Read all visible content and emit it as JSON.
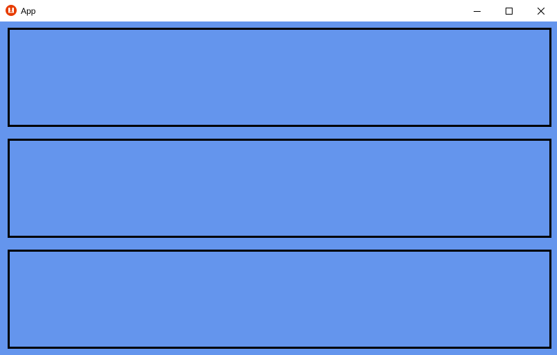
{
  "window": {
    "title": "App",
    "app_icon": "monogame-logo-icon",
    "background_color": "#6495ED",
    "titlebar_color": "#FFFFFF",
    "controls": {
      "minimize": "minimize-icon",
      "maximize": "maximize-icon",
      "close": "close-icon"
    }
  },
  "panels": [
    {
      "border_color": "#000000"
    },
    {
      "border_color": "#000000"
    },
    {
      "border_color": "#000000"
    }
  ],
  "brand_color": "#E73C00"
}
